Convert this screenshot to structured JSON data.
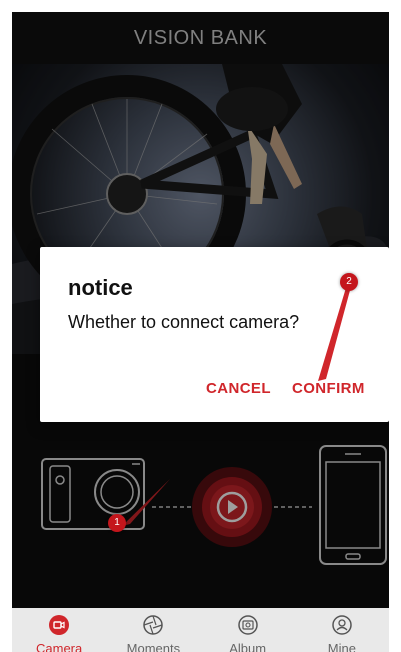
{
  "header": {
    "title": "VISION BANK"
  },
  "dialog": {
    "title": "notice",
    "message": "Whether to connect camera?",
    "cancel_label": "CANCEL",
    "confirm_label": "CONFIRM"
  },
  "badges": {
    "camera": "1",
    "confirm": "2"
  },
  "tabs": [
    {
      "label": "Camera",
      "icon": "camera-icon",
      "active": true
    },
    {
      "label": "Moments",
      "icon": "aperture-icon",
      "active": false
    },
    {
      "label": "Album",
      "icon": "album-icon",
      "active": false
    },
    {
      "label": "Mine",
      "icon": "user-icon",
      "active": false
    }
  ],
  "colors": {
    "accent": "#d0262b",
    "badge": "#c4161c"
  }
}
